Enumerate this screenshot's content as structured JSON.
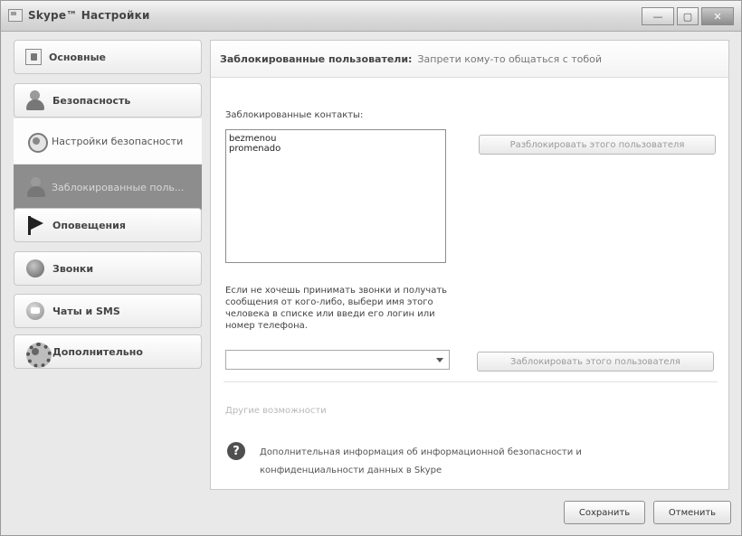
{
  "window": {
    "title": "Skype™ Настройки",
    "controls": {
      "minimize": "—",
      "maximize": "▢",
      "close": "✕"
    }
  },
  "sidebar": {
    "items": [
      {
        "label": "Основные",
        "icon": "general-icon"
      },
      {
        "label": "Безопасность",
        "icon": "person-icon"
      },
      {
        "label": "Настройки безопасности",
        "icon": "shield-icon",
        "sub": true
      },
      {
        "label": "Заблокированные поль...",
        "icon": "person-icon",
        "sub": true,
        "active": true
      },
      {
        "label": "Оповещения",
        "icon": "flag-icon"
      },
      {
        "label": "Звонки",
        "icon": "phone-icon"
      },
      {
        "label": "Чаты и SMS",
        "icon": "chat-icon"
      },
      {
        "label": "Дополнительно",
        "icon": "gear-icon"
      }
    ]
  },
  "main": {
    "header_title": "Заблокированные пользователи:",
    "header_subtitle": "Запрети кому-то общаться с тобой",
    "blocked_label": "Заблокированные контакты:",
    "blocked_contacts": [
      "bezmenou",
      "promenado"
    ],
    "unblock_button": "Разблокировать этого пользователя",
    "instructions": "Если не хочешь принимать звонки и получать сообщения от кого-либо, выбери имя этого человека в списке или введи его логин или номер телефона.",
    "combo_value": "",
    "block_button": "Заблокировать этого пользователя",
    "other_options": "Другие возможности",
    "help_text": "Дополнительная информация об информационной безопасности и конфиденциальности данных в Skype"
  },
  "footer": {
    "save": "Сохранить",
    "cancel": "Отменить"
  },
  "colors": {
    "active_sidebar_bg": "#8d8d8d",
    "window_bg": "#e9e9e9",
    "panel_bg": "#ffffff"
  }
}
